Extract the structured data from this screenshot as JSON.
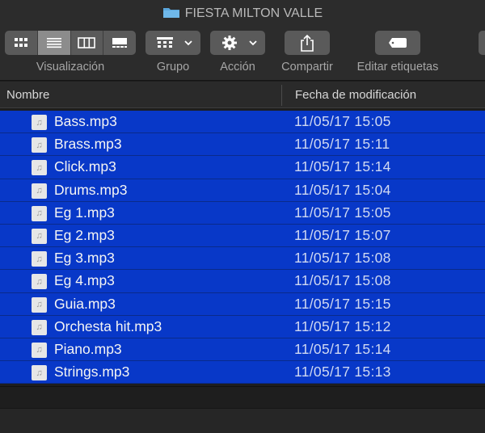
{
  "window": {
    "title": "FIESTA MILTON VALLE",
    "folder_icon": "folder-icon"
  },
  "toolbar": {
    "view_label": "Visualización",
    "group_label": "Grupo",
    "action_label": "Acción",
    "share_label": "Compartir",
    "tags_label": "Editar etiquetas"
  },
  "columns": {
    "name": "Nombre",
    "modified": "Fecha de modificación"
  },
  "selection_color": "#0838c8",
  "files": [
    {
      "name": "Bass.mp3",
      "date": "11/05/17 15:05"
    },
    {
      "name": "Brass.mp3",
      "date": "11/05/17 15:11"
    },
    {
      "name": "Click.mp3",
      "date": "11/05/17 15:14"
    },
    {
      "name": "Drums.mp3",
      "date": "11/05/17 15:04"
    },
    {
      "name": "Eg 1.mp3",
      "date": "11/05/17 15:05"
    },
    {
      "name": "Eg 2.mp3",
      "date": "11/05/17 15:07"
    },
    {
      "name": "Eg 3.mp3",
      "date": "11/05/17 15:08"
    },
    {
      "name": "Eg 4.mp3",
      "date": "11/05/17 15:08"
    },
    {
      "name": "Guia.mp3",
      "date": "11/05/17 15:15"
    },
    {
      "name": "Orchesta hit.mp3",
      "date": "11/05/17 15:12"
    },
    {
      "name": "Piano.mp3",
      "date": "11/05/17 15:14"
    },
    {
      "name": "Strings.mp3",
      "date": "11/05/17 15:13"
    }
  ]
}
